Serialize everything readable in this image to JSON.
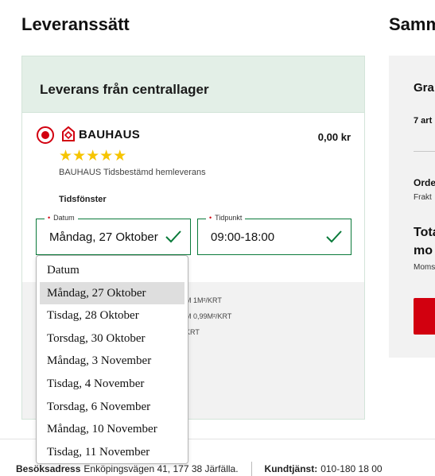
{
  "section": {
    "title": "Leveranssätt",
    "summary_title": "Samm"
  },
  "delivery": {
    "header": "Leverans från centrallager",
    "logo_text": "BAUHAUS",
    "price": "0,00 kr",
    "rating": 5,
    "service": "BAUHAUS Tidsbestämd hemleverans",
    "timewindow_label": "Tidsfönster",
    "date_field": {
      "label": "Datum",
      "value": "Måndag, 27 Oktober"
    },
    "time_field": {
      "label": "Tidpunkt",
      "value": "09:00-18:00"
    },
    "grey_lines": [
      "M 1M²/KRT",
      "M 0,99M²/KRT",
      "KRT"
    ]
  },
  "dropdown": {
    "options": [
      "Datum",
      "Måndag, 27 Oktober",
      "Tisdag, 28 Oktober",
      "Torsdag, 30 Oktober",
      "Måndag, 3 November",
      "Tisdag, 4 November",
      "Torsdag, 6 November",
      "Måndag, 10 November",
      "Tisdag, 11 November"
    ],
    "selected": "Måndag, 27 Oktober"
  },
  "summary": {
    "title_partial": "Gra",
    "count_partial": "7 art",
    "order_partial": "Orde",
    "frakt_partial": "Frakt",
    "total_line1": "Tota",
    "total_line2": "mo",
    "moms_partial": "Moms"
  },
  "footer": {
    "address_label": "Besöksadress",
    "address": "Enköpingsvägen 41, 177 38 Järfälla.",
    "service_label": "Kundtjänst:",
    "phone": "010-180 18 00"
  },
  "colors": {
    "brand_red": "#d2000f",
    "valid_green": "#0a7a3a",
    "header_green": "#e3efe7",
    "star_yellow": "#f6c400"
  }
}
